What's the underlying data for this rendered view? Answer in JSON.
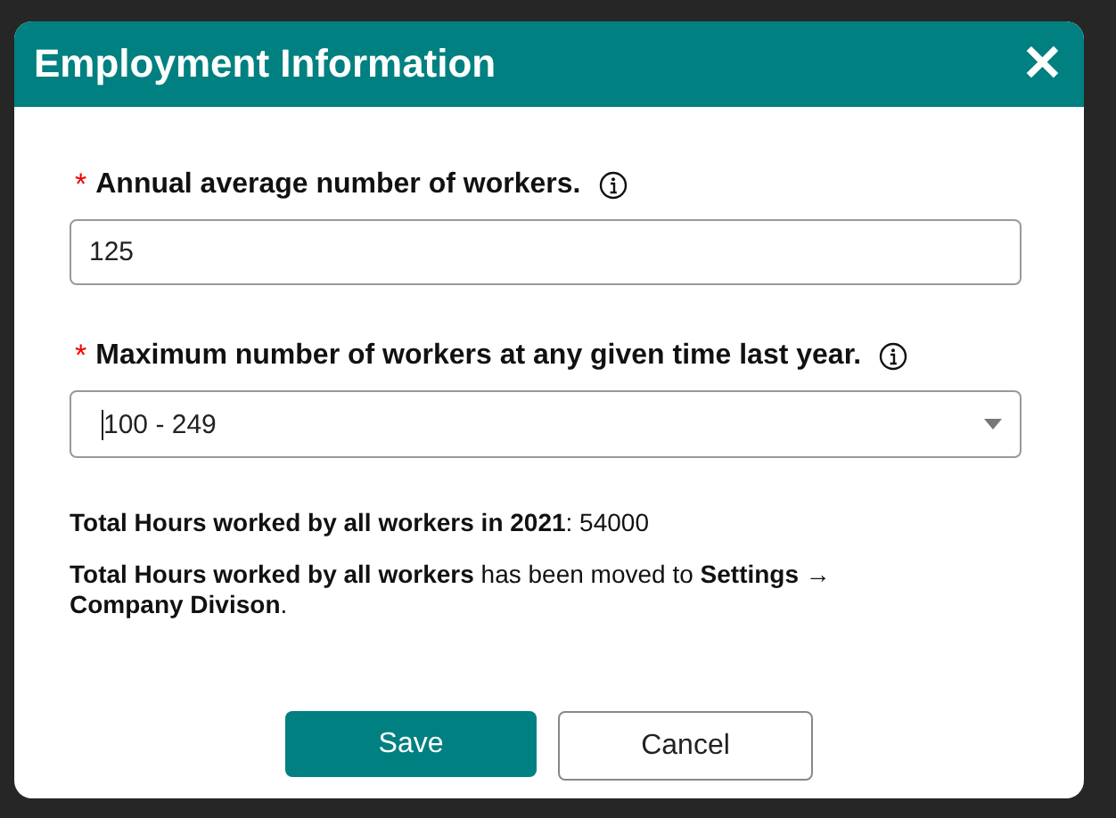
{
  "dialog": {
    "title": "Employment Information",
    "close_icon": "✕"
  },
  "fields": [
    {
      "kind": "text",
      "required": true,
      "label": "Annual average number of workers.",
      "value": "125"
    },
    {
      "kind": "select",
      "required": true,
      "label": "Maximum number of workers at any given time last year.",
      "value": "100 - 249"
    }
  ],
  "required_mark": "*",
  "total_hours": "**Total Hours worked by all workers in 2021**: 54000",
  "notice": "**Total Hours worked by all workers** has been moved to **Settings → Company Divison**.",
  "buttons": [
    {
      "kind": "primary",
      "label": "Save"
    },
    {
      "kind": "secondary",
      "label": "Cancel"
    }
  ]
}
